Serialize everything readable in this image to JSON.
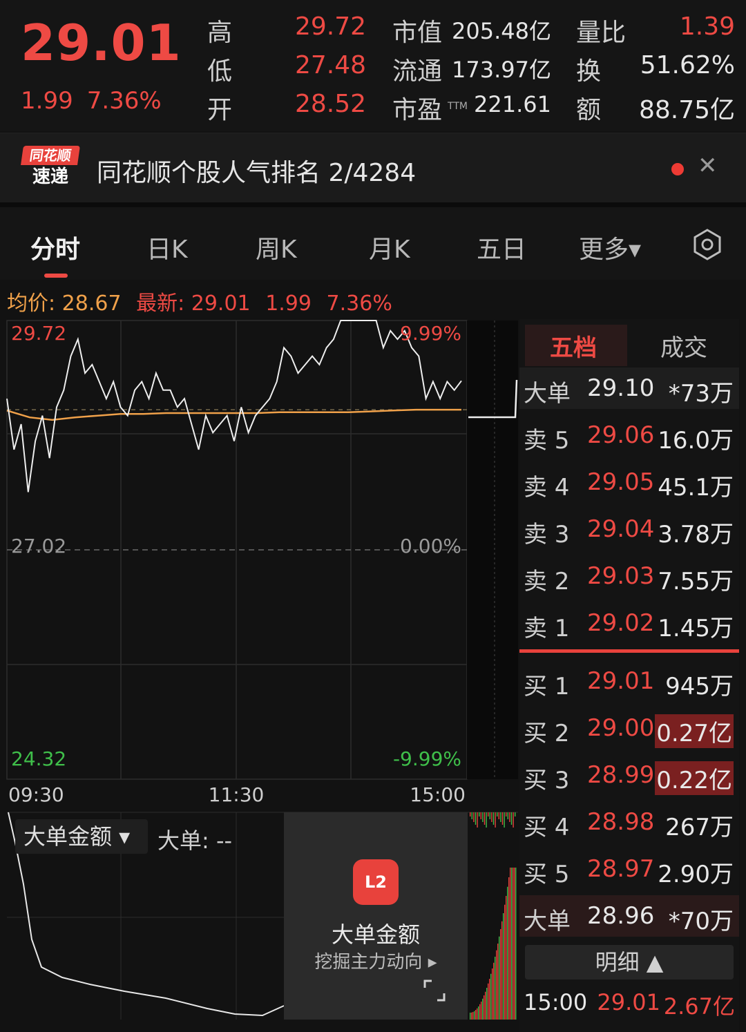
{
  "header": {
    "price": "29.01",
    "change": "1.99",
    "change_pct": "7.36%",
    "stats": [
      {
        "k": "高",
        "v": "29.72",
        "color": "#ee4a44"
      },
      {
        "k": "低",
        "v": "27.48",
        "color": "#ee4a44"
      },
      {
        "k": "开",
        "v": "28.52",
        "color": "#ee4a44"
      },
      {
        "k": "市值",
        "v": "205.48亿",
        "color": "#e6e6e6"
      },
      {
        "k": "流通",
        "v": "173.97亿",
        "color": "#e6e6e6"
      },
      {
        "k": "市盈",
        "sup": "TTM",
        "v": "221.61",
        "color": "#e6e6e6"
      },
      {
        "k": "量比",
        "v": "1.39",
        "color": "#ee4a44"
      },
      {
        "k": "换",
        "v": "51.62%",
        "color": "#e6e6e6"
      },
      {
        "k": "额",
        "v": "88.75亿",
        "color": "#e6e6e6"
      }
    ]
  },
  "banner": {
    "logo_top": "同花顺",
    "logo_bottom": "速递",
    "text": "同花顺个股人气排名 2/4284",
    "close": "✕"
  },
  "tabs": [
    "分时",
    "日K",
    "周K",
    "月K",
    "五日",
    "更多▾"
  ],
  "settings_icon": "hexagon-settings-icon",
  "infoline": {
    "avg_label": "均价:",
    "avg": "28.67",
    "latest_label": "最新:",
    "latest": "29.01",
    "change": "1.99",
    "change_pct": "7.36%"
  },
  "chart_data": {
    "type": "line",
    "y_left_ticks": [
      "29.72",
      "27.02",
      "24.32"
    ],
    "y_right_ticks": [
      "9.99%",
      "0.00%",
      "-9.99%"
    ],
    "x_ticks": [
      "09:30",
      "11:30",
      "15:00"
    ],
    "ylim": [
      24.32,
      29.72
    ],
    "series": [
      {
        "values": [
          28.8,
          28.2,
          28.5,
          27.7,
          28.3,
          28.6,
          28.1,
          28.7,
          28.9,
          29.3,
          29.5,
          29.1,
          29.2,
          29.0,
          28.8,
          29.0,
          28.7,
          28.6,
          28.9,
          29.0,
          28.8,
          29.1,
          28.9,
          28.9,
          28.7,
          28.8,
          28.5,
          28.2,
          28.6,
          28.4,
          28.5,
          28.6,
          28.3,
          28.7,
          28.4,
          28.6,
          28.7,
          28.8,
          29.0,
          29.4,
          29.3,
          29.1,
          29.2,
          29.3,
          29.2,
          29.4,
          29.5,
          29.72,
          29.72,
          29.72,
          29.72,
          29.72,
          29.72,
          29.4,
          29.6,
          29.5,
          29.6,
          29.4,
          29.3,
          28.8,
          29.0,
          28.8,
          29.0,
          28.9,
          29.01
        ]
      },
      {
        "values": [
          28.66,
          28.58,
          28.55,
          28.58,
          28.6,
          28.62,
          28.62,
          28.63,
          28.63,
          28.63,
          28.63,
          28.63,
          28.64,
          28.64,
          28.64,
          28.64,
          28.65,
          28.66,
          28.67,
          28.67,
          28.67
        ]
      }
    ]
  },
  "orderbook": {
    "tabs": [
      "五档",
      "成交"
    ],
    "big_sell": {
      "label": "大单",
      "price": "29.10",
      "vol": "*73万"
    },
    "sell": [
      {
        "label": "卖 5",
        "price": "29.06",
        "vol": "16.0万"
      },
      {
        "label": "卖 4",
        "price": "29.05",
        "vol": "45.1万"
      },
      {
        "label": "卖 3",
        "price": "29.04",
        "vol": "3.78万"
      },
      {
        "label": "卖 2",
        "price": "29.03",
        "vol": "7.55万"
      },
      {
        "label": "卖 1",
        "price": "29.02",
        "vol": "1.45万"
      }
    ],
    "buy": [
      {
        "label": "买 1",
        "price": "29.01",
        "vol": "945万"
      },
      {
        "label": "买 2",
        "price": "29.00",
        "vol": "0.27亿"
      },
      {
        "label": "买 3",
        "price": "28.99",
        "vol": "0.22亿"
      },
      {
        "label": "买 4",
        "price": "28.98",
        "vol": "267万"
      },
      {
        "label": "买 5",
        "price": "28.97",
        "vol": "2.90万"
      }
    ],
    "big_buy": {
      "label": "大单",
      "price": "28.96",
      "vol": "*70万"
    },
    "detail_label": "明细 ▲",
    "last_trade": {
      "time": "15:00",
      "price": "29.01",
      "amount": "2.67亿"
    }
  },
  "subchart": {
    "select_label": "大单金额 ▾",
    "value_label": "大单: --"
  },
  "promo": {
    "icon_text": "L2",
    "title": "大单金额",
    "subtitle": "挖掘主力动向 ▸",
    "expand_icon": "expand-icon"
  }
}
